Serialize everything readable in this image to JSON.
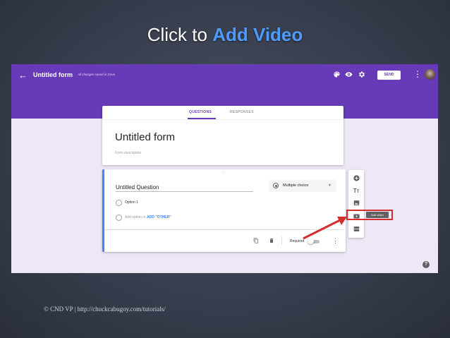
{
  "slide": {
    "title_prefix": "Click to ",
    "title_accent": "Add Video",
    "footer": "© CND VP | http://chuckcabugoy.com/tutorials/",
    "accent_color": "#4f9cff"
  },
  "form_app": {
    "topbar": {
      "back_icon": "arrow-left-icon",
      "form_name": "Untitled form",
      "saved_status": "All changes saved in Drive",
      "icons": [
        "palette-icon",
        "eye-icon",
        "gear-icon"
      ],
      "send_label": "SEND",
      "more_icon": "more-vert-icon",
      "brand_color": "#673ab7"
    },
    "tabs": [
      {
        "label": "QUESTIONS",
        "active": true
      },
      {
        "label": "RESPONSES",
        "active": false
      }
    ],
    "header": {
      "title": "Untitled form",
      "description_placeholder": "Form description"
    },
    "question": {
      "drag_handle": ":::",
      "title": "Untitled Question",
      "type": "Multiple choice",
      "options": [
        "Option 1"
      ],
      "add_option": "Add option",
      "or_text": " or ",
      "add_other": "ADD \"OTHER\"",
      "required_label": "Required",
      "required": false
    },
    "side_toolbar": {
      "items": [
        "add-question-icon",
        "title-text-icon",
        "image-icon",
        "video-icon",
        "section-icon"
      ],
      "tooltip": "Add video"
    },
    "help_icon": "?"
  }
}
